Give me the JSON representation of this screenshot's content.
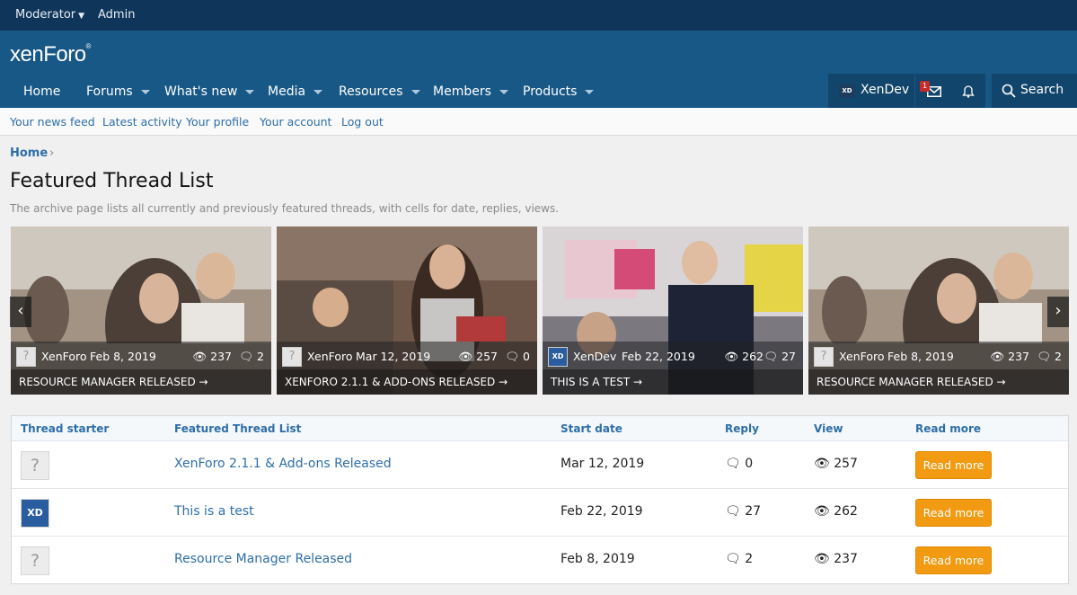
{
  "staffbar": {
    "moderator": "Moderator",
    "admin": "Admin"
  },
  "logo": "xenForo",
  "nav": {
    "tabs": [
      {
        "label": "Home"
      },
      {
        "label": "Forums"
      },
      {
        "label": "What's new"
      },
      {
        "label": "Media"
      },
      {
        "label": "Resources"
      },
      {
        "label": "Members"
      },
      {
        "label": "Products"
      }
    ],
    "account_badge": "XD",
    "account_name": "XenDev",
    "inbox_count": "1",
    "search_label": "Search"
  },
  "subnav": [
    "Your news feed",
    "Latest activity",
    "Your profile",
    "Your account",
    "Log out"
  ],
  "breadcrumb": "Home",
  "page": {
    "title": "Featured Thread List",
    "description": "The archive page lists all currently and previously featured threads, with cells for date, replies, views."
  },
  "carousel": [
    {
      "avatar": "?",
      "user": "XenForo",
      "date": "Feb 8, 2019",
      "views": "237",
      "replies": "2",
      "caption": "RESOURCE MANAGER RELEASED  →",
      "bg": "#8f8276"
    },
    {
      "avatar": "?",
      "user": "XenForo",
      "date": "Mar 12, 2019",
      "views": "257",
      "replies": "0",
      "caption": "XENFORO 2.1.1 & ADD-ONS RELEASED  →",
      "bg": "#6f5a4c"
    },
    {
      "avatar": "XD",
      "user": "XenDev",
      "date": "Feb 22, 2019",
      "views": "262",
      "replies": "27",
      "caption": "THIS IS A TEST  →",
      "bg": "#7d7a80"
    },
    {
      "avatar": "?",
      "user": "XenForo",
      "date": "Feb 8, 2019",
      "views": "237",
      "replies": "2",
      "caption": "RESOURCE MANAGER RELEASED  →",
      "bg": "#8f8276"
    }
  ],
  "table": {
    "headers": [
      "Thread starter",
      "Featured Thread List",
      "Start date",
      "Reply",
      "View",
      "Read more"
    ],
    "rows": [
      {
        "avatar": "?",
        "title": "XenForo 2.1.1 & Add-ons Released",
        "date": "Mar 12, 2019",
        "replies": "0",
        "views": "257",
        "button": "Read more"
      },
      {
        "avatar": "XD",
        "title": "This is a test",
        "date": "Feb 22, 2019",
        "replies": "27",
        "views": "262",
        "button": "Read more"
      },
      {
        "avatar": "?",
        "title": "Resource Manager Released",
        "date": "Feb 8, 2019",
        "replies": "2",
        "views": "237",
        "button": "Read more"
      }
    ]
  },
  "colors": {
    "header": "#185886",
    "staffbar": "#0f355a",
    "link": "#2d6ea8",
    "button": "#f29a12"
  }
}
